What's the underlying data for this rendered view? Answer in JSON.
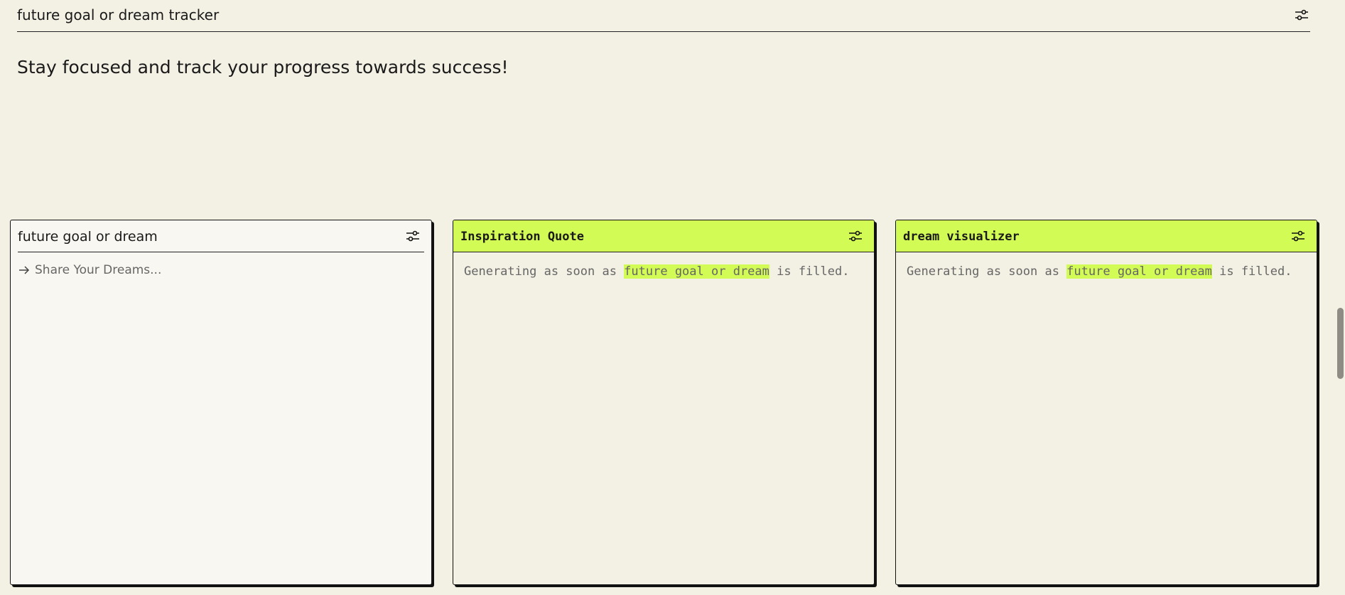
{
  "app": {
    "title": "future goal or dream tracker",
    "subtitle": "Stay focused and track your progress towards success!"
  },
  "cards": {
    "input": {
      "title": "future goal or dream",
      "placeholder": "Share Your Dreams..."
    },
    "quote": {
      "title": "Inspiration Quote",
      "status_prefix": "Generating as soon as ",
      "status_highlight": "future goal or dream",
      "status_suffix": " is filled."
    },
    "visualizer": {
      "title": "dream visualizer",
      "status_prefix": "Generating as soon as ",
      "status_highlight": "future goal or dream",
      "status_suffix": " is filled."
    }
  },
  "icons": {
    "settings": "sliders-icon",
    "arrow": "arrow-right-icon"
  },
  "colors": {
    "background": "#f3f0e4",
    "accent": "#d3fb55",
    "border": "#111111"
  }
}
